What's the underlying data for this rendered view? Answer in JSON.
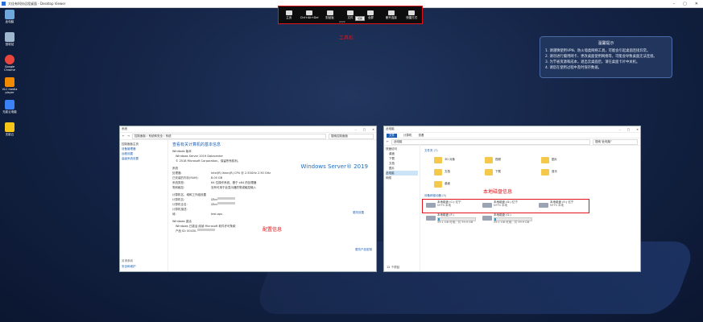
{
  "window": {
    "title": "大佳有科技远程桌面 - Desktop Viewer"
  },
  "desktop_icons": [
    {
      "label": "此电脑",
      "color": "#6fa8dc"
    },
    {
      "label": "回收站",
      "color": "#9fb6cf"
    },
    {
      "label": "Google Chrome",
      "color": "#e8453c"
    },
    {
      "label": "VLC media player",
      "color": "#f08a00"
    },
    {
      "label": "无影云电脑",
      "color": "#3b82f6"
    },
    {
      "label": "无影云",
      "color": "#f5c518"
    }
  ],
  "toolbar": {
    "items": [
      "主页",
      "Ctrl+Alt+Del",
      "剪贴板",
      "文件",
      "全屏",
      "断开连接",
      "快捷方式"
    ],
    "tooltip": "切换",
    "sub_value": "2222"
  },
  "labels": {
    "toolbar": "工具栏",
    "config": "配置信息",
    "disk": "本地磁盘信息"
  },
  "notice": {
    "title": "温馨提示",
    "lines": [
      "1. 请谨慎使用VPN、防火墙类网络工具，可能会引起桌面连接异常。",
      "2. 请勿进行摄用网卡、更改桌面使用网络等，可能会导致桌面无法连接。",
      "3. 为节省资源和成本，退出云桌面后，请在桌面卡片中关机。",
      "4. 请您在使用过程中及时保存数据。"
    ]
  },
  "sysinfo": {
    "title": "系统",
    "breadcrumb": "控制面板 › 系统和安全 › 系统",
    "search": "搜索控制面板",
    "sidebar": [
      "控制面板主页",
      "设备管理器",
      "远程设置",
      "高级系统设置"
    ],
    "sidebar_bottom": [
      "另请参阅",
      "安全和维护"
    ],
    "heading": "查看有关计算机的基本信息",
    "edition_h": "Windows 版本",
    "edition": "Windows Server 2019 Datacenter",
    "copyright": "© 2018 Microsoft Corporation。保留所有权利。",
    "brand": "Windows Server® 2019",
    "system_h": "系统",
    "rows": [
      {
        "k": "处理器:",
        "v": "Intel(R) Xeon(R) CPU @ 2.50GHz   2.50 GHz"
      },
      {
        "k": "已安装的内存(RAM):",
        "v": "8.00 GB"
      },
      {
        "k": "系统类型:",
        "v": "64 位操作系统，基于 x64 的处理器"
      },
      {
        "k": "笔和触控:",
        "v": "没有可用于此显示器的笔或触控输入"
      }
    ],
    "computer_h": "计算机名、域和工作组设置",
    "name_rows": [
      {
        "k": "计算机名:",
        "v": "iZbn"
      },
      {
        "k": "计算机全名:",
        "v": "iZbn"
      },
      {
        "k": "计算机描述:",
        "v": ""
      },
      {
        "k": "域:",
        "v": "test.ops"
      }
    ],
    "change_settings": "更改设置",
    "activation_h": "Windows 激活",
    "activation": "Windows 已激活  阅读 Microsoft 软件许可条款",
    "product_id": "产品 ID: 00430-",
    "change_key": "更改产品密钥"
  },
  "explorer": {
    "title": "此电脑",
    "tabs": [
      "文件",
      "计算机",
      "查看"
    ],
    "path": "此电脑",
    "search": "搜索\"此电脑\"",
    "sidebar": [
      "快速访问",
      "桌面",
      "下载",
      "文档",
      "图片",
      "此电脑",
      "网络"
    ],
    "folders_h": "文件夹 (7)",
    "folders": [
      "3D 对象",
      "视频",
      "图片",
      "文档",
      "下载",
      "音乐",
      "桌面"
    ],
    "drives_h": "设备和驱动器 (5)",
    "drives": [
      {
        "name": "本地磁盘 (C:) 亿宁",
        "size": "NTFS 本地",
        "fill": 0.3
      },
      {
        "name": "本地磁盘 (D:) 亿宁",
        "size": "NTFS 本地",
        "fill": 0.1
      },
      {
        "name": "本地磁盘 (E:) 亿宁",
        "size": "NTFS 本地",
        "fill": 0.1
      },
      {
        "name": "本地磁盘 (F:)",
        "size": "39.1 GB 可用，共 39.9 GB",
        "fill": 0.05
      },
      {
        "name": "本地磁盘 (G:)",
        "size": "39.1 GB 可用，共 39.9 GB",
        "fill": 0.05
      }
    ],
    "status": "12 个项目"
  }
}
